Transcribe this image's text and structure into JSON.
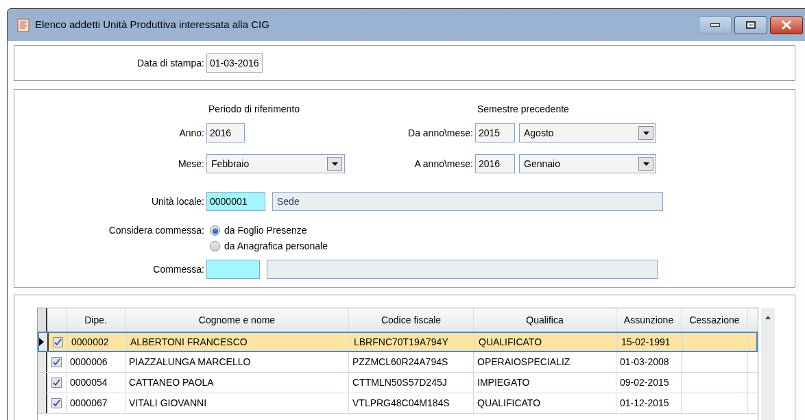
{
  "window": {
    "title": "Elenco addetti Unità Produttiva interessata alla CIG"
  },
  "print_date": {
    "label": "Data di stampa:",
    "value": "01-03-2016"
  },
  "period": {
    "heading": "Periodo di riferimento",
    "year": {
      "label": "Anno:",
      "value": "2016"
    },
    "month": {
      "label": "Mese:",
      "value": "Febbraio"
    }
  },
  "previous_semester": {
    "heading": "Semestre precedente",
    "from": {
      "label": "Da anno\\mese:",
      "year": "2015",
      "month": "Agosto"
    },
    "to": {
      "label": "A anno\\mese:",
      "year": "2016",
      "month": "Gennaio"
    }
  },
  "local_unit": {
    "label": "Unità locale:",
    "code": "0000001",
    "name": "Sede"
  },
  "job_source": {
    "label": "Considera commessa:",
    "options": [
      {
        "label": "da Foglio Presenze",
        "selected": true
      },
      {
        "label": "da Anagrafica personale",
        "selected": false
      }
    ]
  },
  "job": {
    "label": "Commessa:"
  },
  "table": {
    "columns": [
      "Dipe.",
      "Cognome e nome",
      "Codice fiscale",
      "Qualifica",
      "Assunzione",
      "Cessazione"
    ],
    "rows": [
      {
        "selected": true,
        "checked": true,
        "cells": [
          "0000002",
          "ALBERTONI FRANCESCO",
          "LBRFNC70T19A794Y",
          "QUALIFICATO",
          "15-02-1991"
        ]
      },
      {
        "selected": false,
        "checked": true,
        "cells": [
          "0000006",
          "PIAZZALUNGA MARCELLO",
          "PZZMCL60R24A794S",
          "OPERAIOSPECIALIZ",
          "01-03-2008"
        ]
      },
      {
        "selected": false,
        "checked": true,
        "cells": [
          "0000054",
          "CATTANEO PAOLA",
          "CTTMLN50S57D245J",
          "IMPIEGATO",
          "09-02-2015"
        ]
      },
      {
        "selected": false,
        "checked": true,
        "cells": [
          "0000067",
          "VITALI GIOVANNI",
          "VTLPRG48C04M184S",
          "QUALIFICATO",
          "01-12-2015"
        ]
      }
    ]
  }
}
